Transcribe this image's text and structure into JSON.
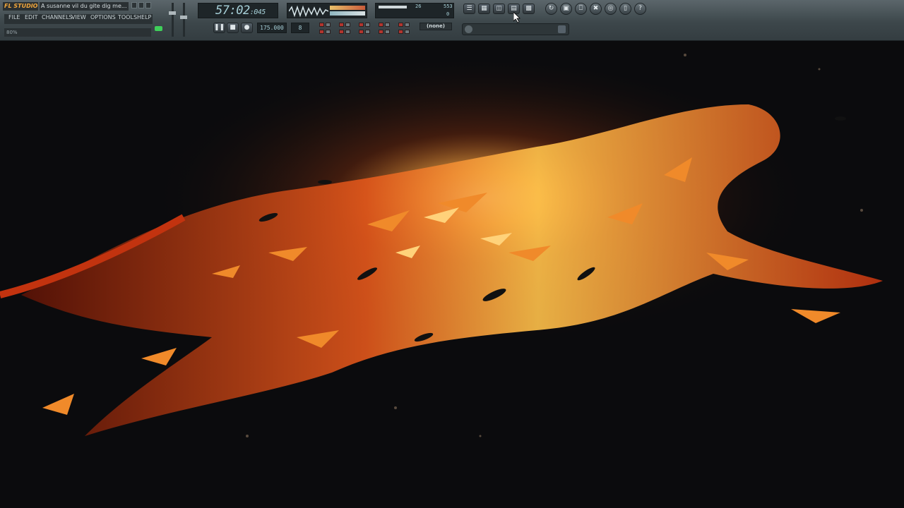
{
  "app": {
    "logo": "FL STUDIO",
    "title": "A susanne vil du gite dig me...",
    "menu": [
      "FILE",
      "EDIT",
      "CHANNELS",
      "VIEW",
      "OPTIONS",
      "TOOLS",
      "HELP"
    ],
    "hint": "80%"
  },
  "transport": {
    "time_main": "57:02",
    "time_ticks": ":045",
    "tempo": "175.000",
    "pattern_num": "8",
    "cpu": "26",
    "mem": "553",
    "poly": "0",
    "pattern_selector": "(none)"
  },
  "icons": {
    "view_buttons": [
      "playlist-icon",
      "step-sequencer-icon",
      "piano-roll-icon",
      "browser-icon",
      "mixer-icon"
    ],
    "tool_buttons": [
      "refresh-icon",
      "save-icon",
      "render-icon",
      "cut-icon",
      "plugin-picker-icon",
      "project-icon",
      "help-icon"
    ]
  },
  "colors": {
    "toolbar": "#3d474b",
    "lcd_text": "#a7d0d8",
    "accent_orange": "#f2a73c",
    "record_red": "#b3352e"
  }
}
